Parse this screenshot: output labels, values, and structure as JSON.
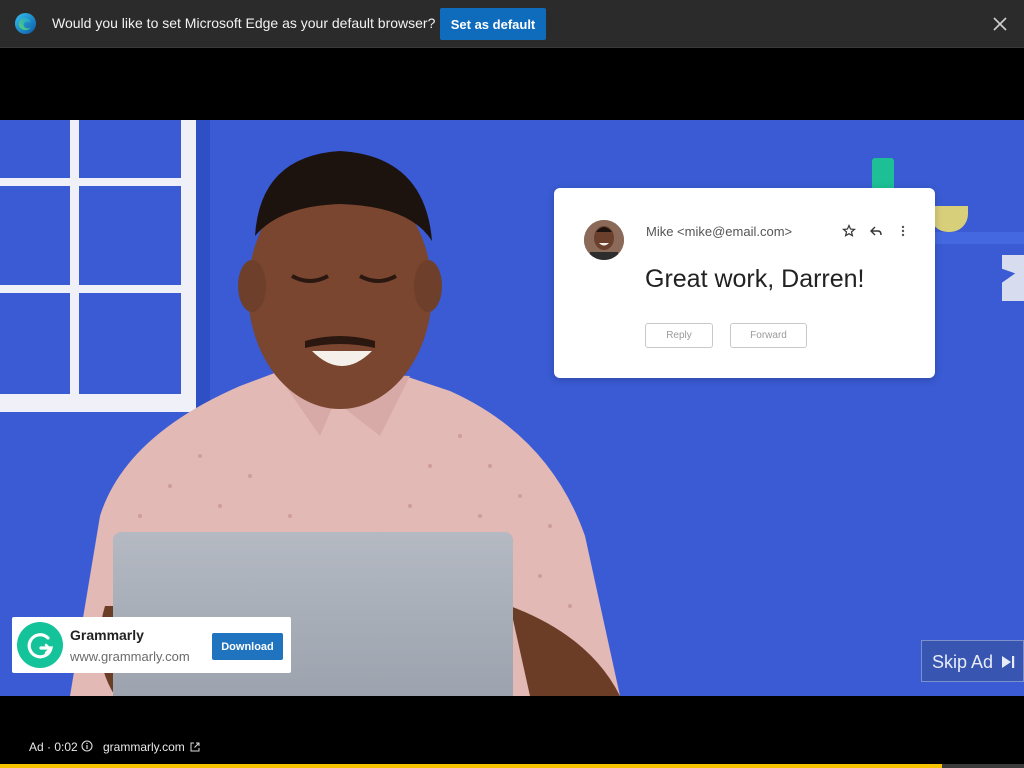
{
  "edge_bar": {
    "message": "Would you like to set Microsoft Edge as your default browser?",
    "set_default_label": "Set as default"
  },
  "email": {
    "from": "Mike <mike@email.com>",
    "subject": "Great work, Darren!",
    "reply_label": "Reply",
    "forward_label": "Forward"
  },
  "ad": {
    "brand": "Grammarly",
    "url": "www.grammarly.com",
    "download_label": "Download",
    "skip_label": "Skip Ad",
    "meta": "Ad · 0:02",
    "domain": "grammarly.com",
    "progress": 0.92
  },
  "colors": {
    "video_bg": "#3a5bd4",
    "grammarly_green": "#15c39a",
    "download_blue": "#1f73bf",
    "edge_button": "#0f6cbd",
    "progress": "#f6c300"
  }
}
